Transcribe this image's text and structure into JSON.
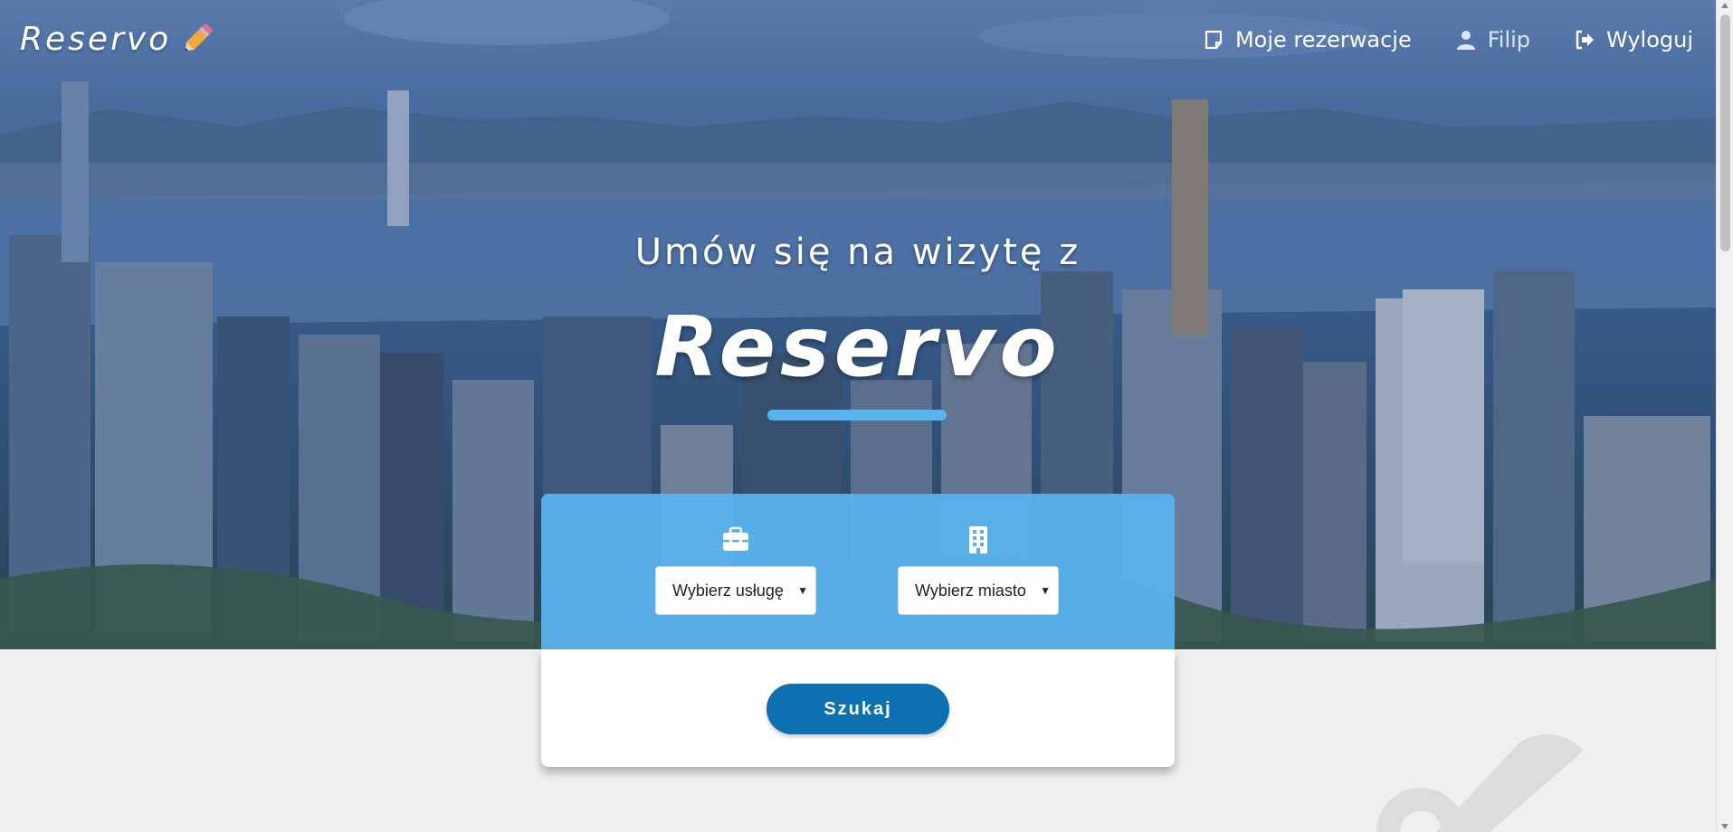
{
  "brand": {
    "name": "Reservo",
    "icon": "pencil-icon"
  },
  "nav": {
    "reservations_label": "Moje rezerwacje",
    "reservations_icon": "note-icon",
    "user_label": "Filip",
    "user_icon": "user-icon",
    "logout_label": "Wyloguj",
    "logout_icon": "logout-icon"
  },
  "hero": {
    "subtitle": "Umów się na wizytę z",
    "title": "Reservo",
    "background": "city-skyline-photo"
  },
  "search": {
    "service_icon": "toolbox-icon",
    "service_select_value": "Wybierz usługę",
    "city_icon": "building-icon",
    "city_select_value": "Wybierz miasto",
    "button_label": "Szukaj"
  },
  "colors": {
    "accent_light": "#58b2ec",
    "button_primary": "#0e6fb1",
    "page_background": "#efefef"
  }
}
